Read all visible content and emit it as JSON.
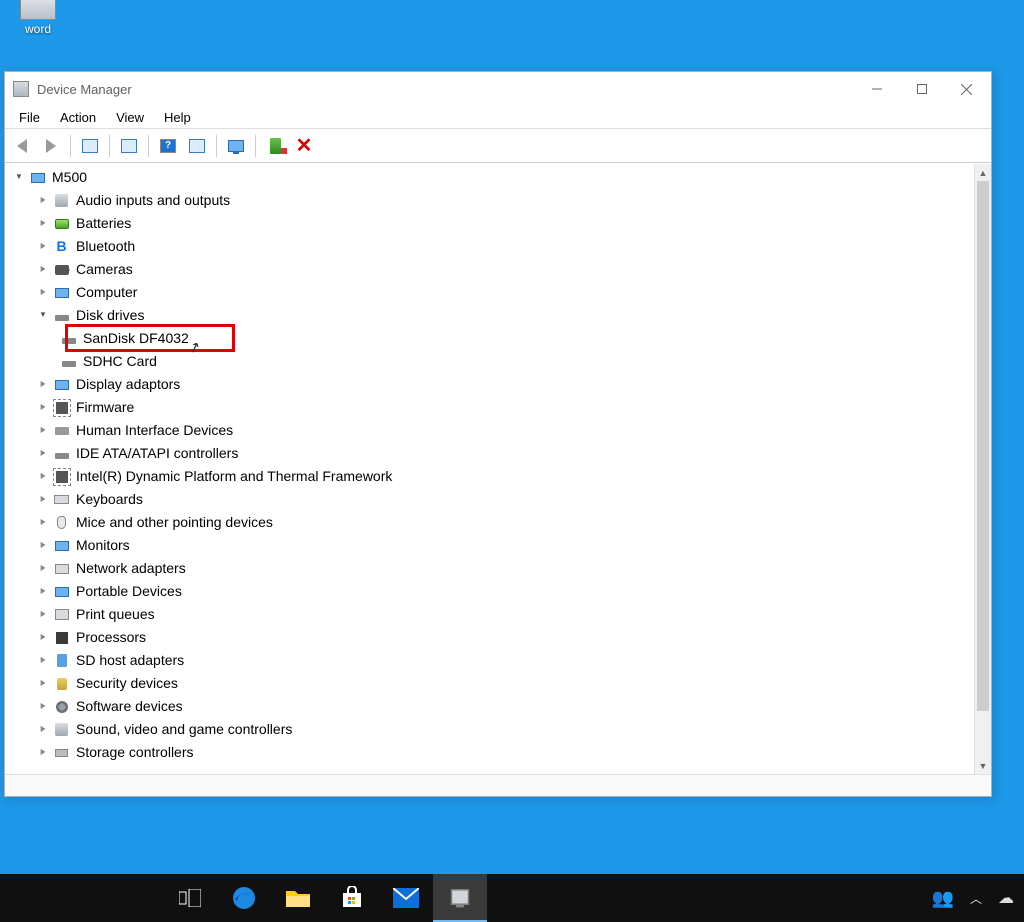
{
  "desktop": {
    "icon_label": "word"
  },
  "window": {
    "title": "Device Manager",
    "menus": [
      "File",
      "Action",
      "View",
      "Help"
    ],
    "toolbar": {
      "back": "Back",
      "forward": "Forward",
      "show_hidden": "Show hidden devices",
      "properties": "Properties",
      "help": "Help",
      "update": "Update driver",
      "scan": "Scan for hardware changes",
      "add": "Add legacy hardware",
      "uninstall": "Uninstall device"
    },
    "tree": {
      "root": {
        "label": "M500",
        "expanded": true
      },
      "categories": [
        {
          "label": "Audio inputs and outputs",
          "icon": "speaker-icon",
          "expanded": false
        },
        {
          "label": "Batteries",
          "icon": "battery-icon",
          "expanded": false
        },
        {
          "label": "Bluetooth",
          "icon": "bluetooth-icon",
          "expanded": false
        },
        {
          "label": "Cameras",
          "icon": "camera-icon",
          "expanded": false
        },
        {
          "label": "Computer",
          "icon": "computer-icon",
          "expanded": false
        },
        {
          "label": "Disk drives",
          "icon": "disk-icon",
          "expanded": true,
          "children": [
            {
              "label": "SanDisk DF4032",
              "icon": "disk-icon",
              "highlight": true
            },
            {
              "label": "SDHC Card",
              "icon": "disk-icon",
              "highlight": false
            }
          ]
        },
        {
          "label": "Display adaptors",
          "icon": "display-icon",
          "expanded": false
        },
        {
          "label": "Firmware",
          "icon": "firmware-icon",
          "expanded": false
        },
        {
          "label": "Human Interface Devices",
          "icon": "hid-icon",
          "expanded": false
        },
        {
          "label": "IDE ATA/ATAPI controllers",
          "icon": "ide-icon",
          "expanded": false
        },
        {
          "label": "Intel(R) Dynamic Platform and Thermal Framework",
          "icon": "chip-icon",
          "expanded": false
        },
        {
          "label": "Keyboards",
          "icon": "keyboard-icon",
          "expanded": false
        },
        {
          "label": "Mice and other pointing devices",
          "icon": "mouse-icon",
          "expanded": false
        },
        {
          "label": "Monitors",
          "icon": "monitor-icon",
          "expanded": false
        },
        {
          "label": "Network adapters",
          "icon": "network-icon",
          "expanded": false
        },
        {
          "label": "Portable Devices",
          "icon": "portable-icon",
          "expanded": false
        },
        {
          "label": "Print queues",
          "icon": "printer-icon",
          "expanded": false
        },
        {
          "label": "Processors",
          "icon": "cpu-icon",
          "expanded": false
        },
        {
          "label": "SD host adapters",
          "icon": "sd-icon",
          "expanded": false
        },
        {
          "label": "Security devices",
          "icon": "security-icon",
          "expanded": false
        },
        {
          "label": "Software devices",
          "icon": "software-icon",
          "expanded": false
        },
        {
          "label": "Sound, video and game controllers",
          "icon": "sound-icon",
          "expanded": false
        },
        {
          "label": "Storage controllers",
          "icon": "storage-icon",
          "expanded": false
        }
      ]
    }
  },
  "taskbar": {
    "items": [
      "task-view",
      "edge",
      "file-explorer",
      "store",
      "mail",
      "device-manager"
    ],
    "tray": {
      "people": "People",
      "up": "Show hidden icons",
      "cloud": "OneDrive"
    }
  }
}
